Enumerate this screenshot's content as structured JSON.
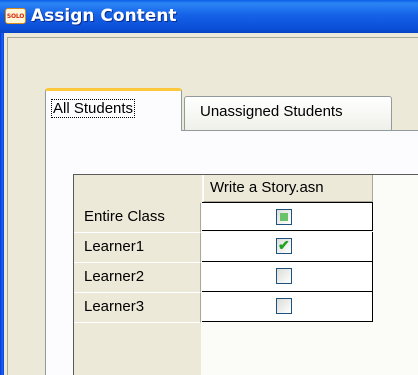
{
  "window": {
    "title": "Assign Content",
    "icon": "solo-app-icon",
    "icon_text": "SOLO"
  },
  "tabs": [
    {
      "label": "All Students",
      "active": true
    },
    {
      "label": "Unassigned Students",
      "active": false
    }
  ],
  "grid": {
    "column_header": "Write a Story.asn",
    "rows": [
      {
        "label": "Entire Class",
        "state": "partial"
      },
      {
        "label": "Learner1",
        "state": "checked"
      },
      {
        "label": "Learner2",
        "state": "unchecked"
      },
      {
        "label": "Learner3",
        "state": "unchecked"
      }
    ]
  },
  "colors": {
    "titlebar": "#0b4fd8",
    "active_tab_accent": "#ffc83c",
    "check_green": "#21a121"
  }
}
